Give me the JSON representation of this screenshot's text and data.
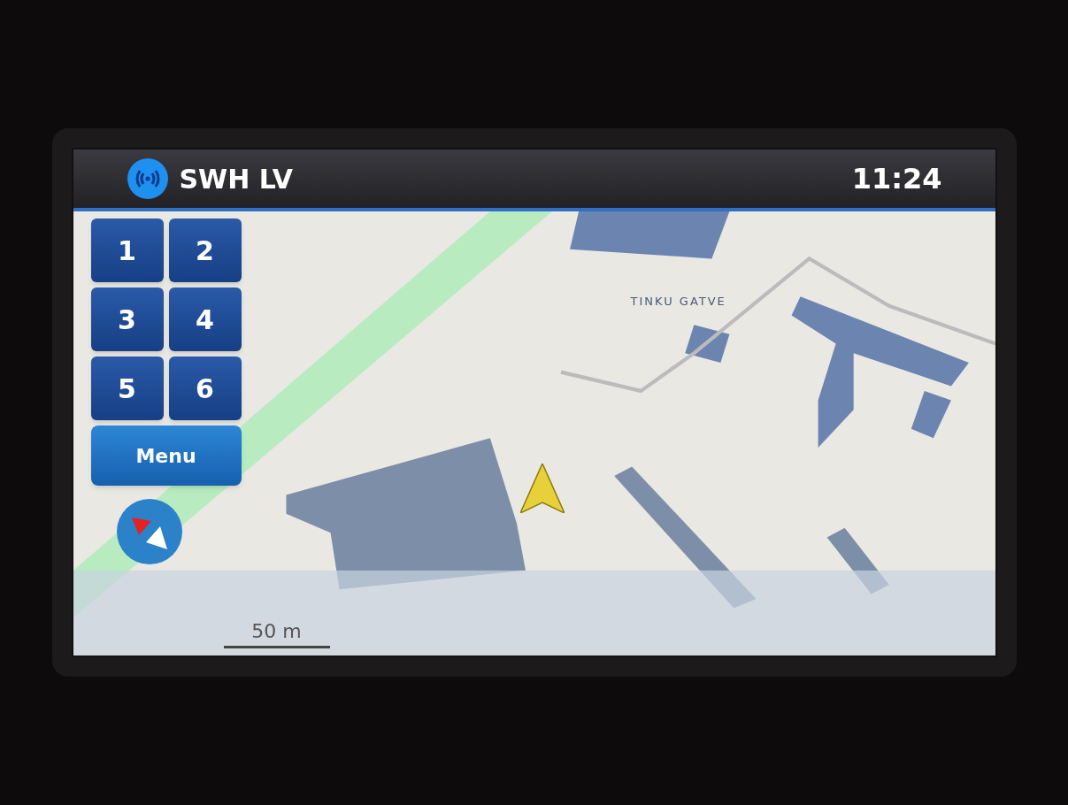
{
  "header": {
    "station": "SWH LV",
    "time": "11:24"
  },
  "presets": [
    {
      "label": "1"
    },
    {
      "label": "2"
    },
    {
      "label": "3"
    },
    {
      "label": "4"
    },
    {
      "label": "5"
    },
    {
      "label": "6"
    }
  ],
  "menu": {
    "label": "Menu"
  },
  "map": {
    "street_label": "TINKU GATVE",
    "scale": "50 m"
  }
}
